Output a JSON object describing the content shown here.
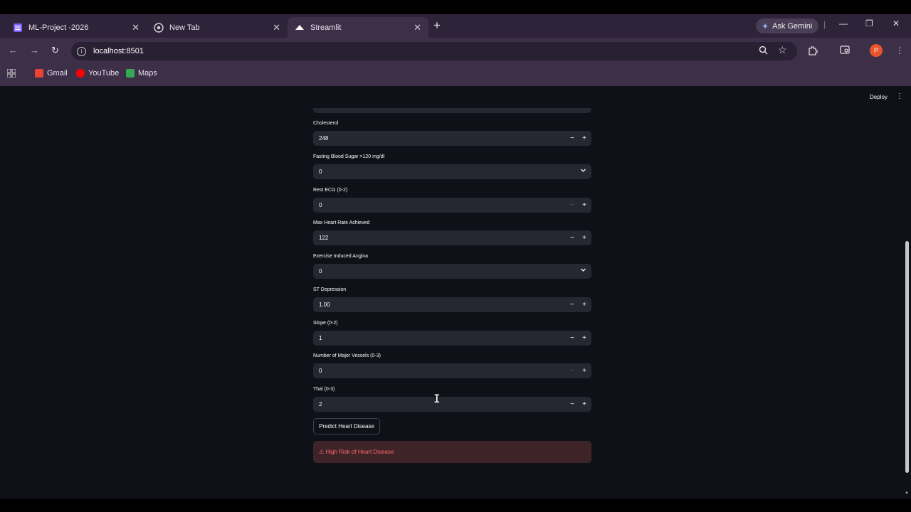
{
  "browser": {
    "tabs": [
      {
        "title": "ML-Project -2026",
        "icon": "list-icon",
        "color": "#7b5cff"
      },
      {
        "title": "New Tab",
        "icon": "chrome-icon",
        "color": "#cfcfcf"
      },
      {
        "title": "Streamlit",
        "icon": "streamlit-icon",
        "color": "#ffffff"
      }
    ],
    "new_tab_glyph": "+",
    "gemini_label": "Ask Gemini",
    "url": "localhost:8501",
    "profile_initial": "P",
    "bookmarks": [
      {
        "label": "Gmail",
        "color": "#ea4335"
      },
      {
        "label": "YouTube",
        "color": "#ff0000"
      },
      {
        "label": "Maps",
        "color": "#34a853"
      }
    ]
  },
  "app": {
    "deploy_label": "Deploy",
    "fields": [
      {
        "label": "Cholesterol",
        "value": "248",
        "kind": "number",
        "minus_disabled": false
      },
      {
        "label": "Fasting Blood Sugar >120 mg/dl",
        "value": "0",
        "kind": "select"
      },
      {
        "label": "Rest ECG (0-2)",
        "value": "0",
        "kind": "number",
        "minus_disabled": true
      },
      {
        "label": "Max Heart Rate Achieved",
        "value": "122",
        "kind": "number",
        "minus_disabled": false
      },
      {
        "label": "Exercise Induced Angina",
        "value": "0",
        "kind": "select"
      },
      {
        "label": "ST Depression",
        "value": "1.00",
        "kind": "number",
        "minus_disabled": false
      },
      {
        "label": "Slope (0-2)",
        "value": "1",
        "kind": "number",
        "minus_disabled": false
      },
      {
        "label": "Number of Major Vessels (0-3)",
        "value": "0",
        "kind": "number",
        "minus_disabled": true
      },
      {
        "label": "Thal (0-3)",
        "value": "2",
        "kind": "number",
        "minus_disabled": false
      }
    ],
    "predict_button": "Predict Heart Disease",
    "result_message": "⚠ High Risk of Heart Disease",
    "colors": {
      "background": "#0e1117",
      "input": "#262730",
      "alert_bg": "#3e2428",
      "alert_text": "#ff6b6b"
    }
  }
}
